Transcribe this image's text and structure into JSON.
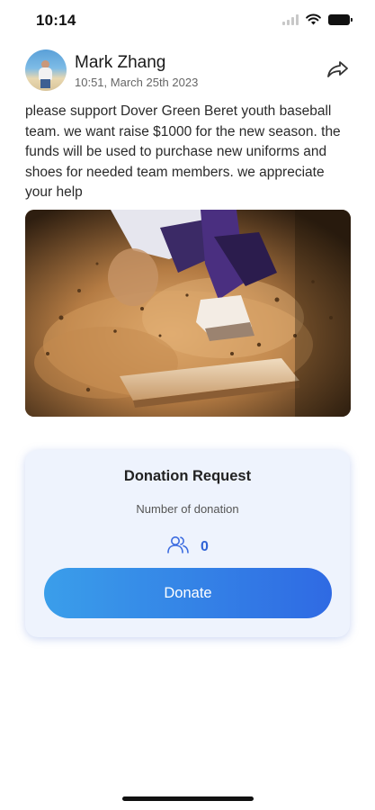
{
  "status_bar": {
    "time": "10:14"
  },
  "post": {
    "author_name": "Mark Zhang",
    "timestamp": "10:51, March 25th 2023",
    "text": "please support Dover Green Beret youth baseball team. we want raise $1000 for the new season. the funds will be used to purchase new uniforms and shoes for needed team members. we appreciate your help"
  },
  "donation": {
    "title": "Donation Request",
    "subtitle": "Number of donation",
    "count": "0",
    "button_label": "Donate"
  },
  "icons": {
    "share": "share-icon",
    "donors": "users-icon",
    "wifi": "wifi-icon",
    "battery": "battery-icon",
    "signal": "signal-icon"
  },
  "colors": {
    "accent": "#2f6ae3",
    "accent_light": "#3a9eea",
    "card_bg": "#eef3fd",
    "count": "#2f63d6"
  }
}
